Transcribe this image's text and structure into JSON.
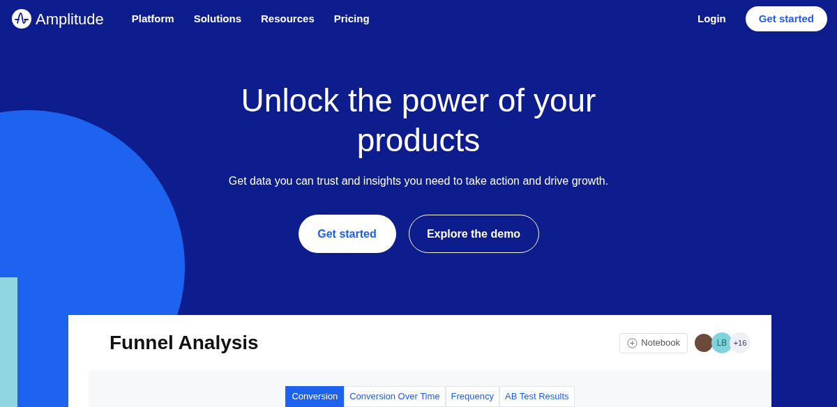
{
  "brand": {
    "name": "Amplitude"
  },
  "nav": [
    {
      "label": "Platform"
    },
    {
      "label": "Solutions"
    },
    {
      "label": "Resources"
    },
    {
      "label": "Pricing"
    }
  ],
  "header_actions": {
    "login": "Login",
    "cta": "Get started"
  },
  "hero": {
    "title": "Unlock the power of your products",
    "subtitle": "Get data you can trust and insights you need to take action and drive growth.",
    "buttons": [
      {
        "label": "Get started",
        "kind": "primary"
      },
      {
        "label": "Explore the demo",
        "kind": "outline"
      }
    ]
  },
  "preview": {
    "title": "Funnel Analysis",
    "notebook": "Notebook",
    "avatars": [
      {
        "kind": "photo"
      },
      {
        "kind": "initials",
        "text": "LB"
      },
      {
        "kind": "count",
        "text": "+16"
      }
    ],
    "tabs": [
      {
        "label": "Conversion",
        "selected": true
      },
      {
        "label": "Conversion Over Time",
        "selected": false
      },
      {
        "label": "Frequency",
        "selected": false
      },
      {
        "label": "AB Test Results",
        "selected": false
      }
    ]
  }
}
